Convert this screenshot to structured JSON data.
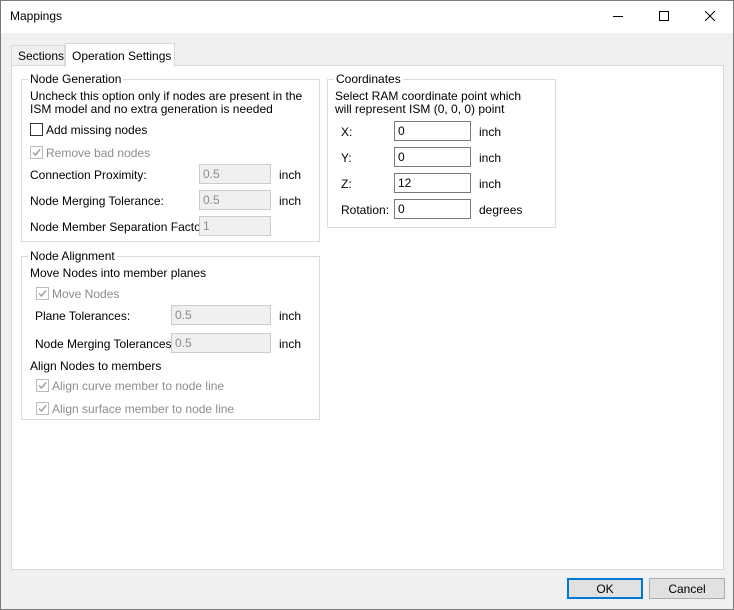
{
  "window": {
    "title": "Mappings"
  },
  "tabs": [
    {
      "label": "Sections",
      "active": false
    },
    {
      "label": "Operation Settings",
      "active": true
    }
  ],
  "node_generation": {
    "legend": "Node Generation",
    "description": "Uncheck this option only if nodes are present in the ISM model and no extra generation is needed",
    "description_line1": "Uncheck this option only if nodes are present in the",
    "description_line2": "ISM model and no extra generation is needed",
    "add_missing_nodes": {
      "label": "Add missing nodes",
      "checked": false
    },
    "remove_bad_nodes": {
      "label": "Remove bad nodes",
      "checked": true,
      "enabled": false
    },
    "connection_proximity": {
      "label": "Connection Proximity:",
      "value": "0.5",
      "unit": "inch"
    },
    "node_merging_tolerance": {
      "label": "Node Merging Tolerance:",
      "value": "0.5",
      "unit": "inch"
    },
    "node_member_separation": {
      "label": "Node Member Separation Factor:",
      "value": "1"
    }
  },
  "node_alignment": {
    "legend": "Node Alignment",
    "move_heading": "Move Nodes into member planes",
    "move_nodes": {
      "label": "Move Nodes",
      "checked": true,
      "enabled": false
    },
    "plane_tolerances": {
      "label": "Plane Tolerances:",
      "value": "0.5",
      "unit": "inch"
    },
    "node_merging_tolerances": {
      "label": "Node Merging Tolerances:",
      "value": "0.5",
      "unit": "inch"
    },
    "align_heading": "Align Nodes to members",
    "align_curve": {
      "label": "Align curve member to node line",
      "checked": true,
      "enabled": false
    },
    "align_surface": {
      "label": "Align surface member to node line",
      "checked": true,
      "enabled": false
    }
  },
  "coordinates": {
    "legend": "Coordinates",
    "description_line1": "Select RAM coordinate point which",
    "description_line2": "will represent ISM (0, 0, 0) point",
    "x": {
      "label": "X:",
      "value": "0",
      "unit": "inch"
    },
    "y": {
      "label": "Y:",
      "value": "0",
      "unit": "inch"
    },
    "z": {
      "label": "Z:",
      "value": "12",
      "unit": "inch"
    },
    "rotation": {
      "label": "Rotation:",
      "value": "0",
      "unit": "degrees"
    }
  },
  "footer": {
    "ok_label": "OK",
    "cancel_label": "Cancel"
  }
}
